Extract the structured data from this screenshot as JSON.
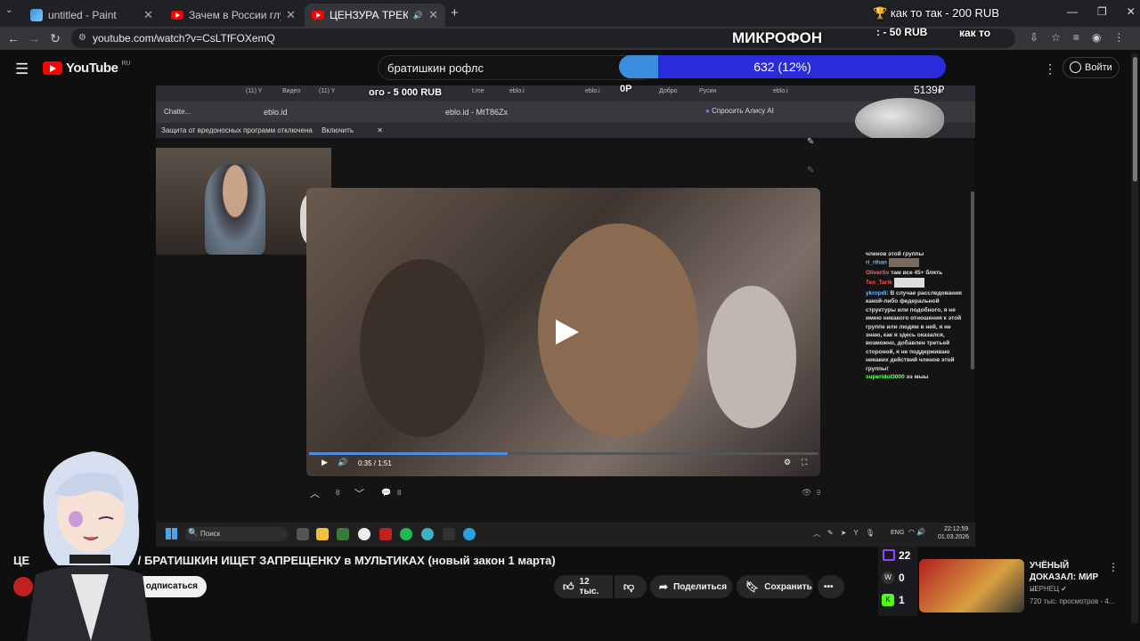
{
  "browser": {
    "tabs": [
      {
        "title": "untitled - Paint",
        "icon": "paint-icon"
      },
      {
        "title": "Зачем в России глушат мобил",
        "icon": "youtube-icon"
      },
      {
        "title": "ЦЕНЗУРА ТРЕКОВ в РФ / БР",
        "icon": "youtube-icon",
        "active": true
      }
    ],
    "new_tab": "+",
    "url": "youtube.com/watch?v=CsLTfFOXemQ"
  },
  "stream_overlay": {
    "donation_line_1": "как то так - 200 RUB",
    "microphone": "МИКРОФОН",
    "donation_line_2": ": - 50 RUB",
    "donation_line_3": "как то",
    "goal_text": "ого - 5 000 RUB",
    "op_text": "0P",
    "rub_counter": "5139₽"
  },
  "youtube": {
    "logo_text": "YouTube",
    "region": "RU",
    "search_value": "братишкин рофлс",
    "goal_bar": {
      "text": "632 (12%)",
      "fraction": 0.12
    },
    "signin_label": "Войти",
    "video_title": "ЦЕНЗУРА ТРЕКОВ в РФ / БРАТИШКИН ИЩЕТ ЗАПРЕЩЕНКУ в МУЛЬТИКАХ (новый закон 1 марта)",
    "title_visible_prefix": "ЦЕ",
    "title_visible_rest": "/ БРАТИШКИН ИЩЕТ ЗАПРЕЩЕНКУ в МУЛЬТИКАХ (новый закон 1 марта)",
    "subscribe_label": "одписаться",
    "likes": "12 тыс.",
    "share_label": "Поделиться",
    "save_label": "Сохранить",
    "more_label": "•••"
  },
  "inner_browser": {
    "back_label": "Chatte...",
    "address": "eblo.id",
    "page_title": "eblo.id - MtT86Zx",
    "alice_label": "Спросить Алису AI",
    "warning_text": "Защита от вредоносных программ отключена",
    "enable_label": "Включить",
    "tabs": [
      "(11) Y",
      "Видео",
      "(11) Y",
      "t.me",
      "eblo.i",
      "eb",
      "eblo.i",
      "eblo.i",
      "Добро",
      "Русин",
      "eb",
      "eblo.i",
      "eb"
    ]
  },
  "inner_video": {
    "time": "0:35 / 1:51",
    "progress_fraction": 0.39,
    "upvote_count": "8",
    "comment_count": "8",
    "views": "9"
  },
  "chat": [
    {
      "user": "",
      "text": "членов этой группы"
    },
    {
      "user": "ri_rihan",
      "text": ""
    },
    {
      "user": "OliverSv",
      "text": "там все 45+ блять"
    },
    {
      "user": "Teo_Tarik",
      "text": ""
    },
    {
      "user": "ykropdi",
      "text": "В случае расследования какой-либо федеральной структуры или подобного, я не имею никакого отношения к этой группе или людям в ней, я не знаю, как я здесь оказался, возможно, добавлен третьей стороной, я не поддерживаю никаких действий членов этой группы!"
    },
    {
      "user": "superidol3000",
      "text": "ээ мыы"
    }
  ],
  "taskbar": {
    "search_placeholder": "Поиск",
    "lang": "ENG",
    "time": "22:12:59",
    "date": "01.03.2026"
  },
  "twitch": {
    "viewers": "22",
    "w_count": "0",
    "k_count": "1"
  },
  "recommendation": {
    "title": "УЧЁНЫЙ ДОКАЗАЛ: МИР ...",
    "channel": "ЧЕРНЕЦ",
    "meta": "720 тыс. просмотров - 4..."
  },
  "colors": {
    "youtube_red": "#ff0000",
    "goal_bar_bg": "#2b2bd9",
    "goal_bar_fill": "#3a8ddc",
    "twitch_purple": "#9146ff"
  }
}
